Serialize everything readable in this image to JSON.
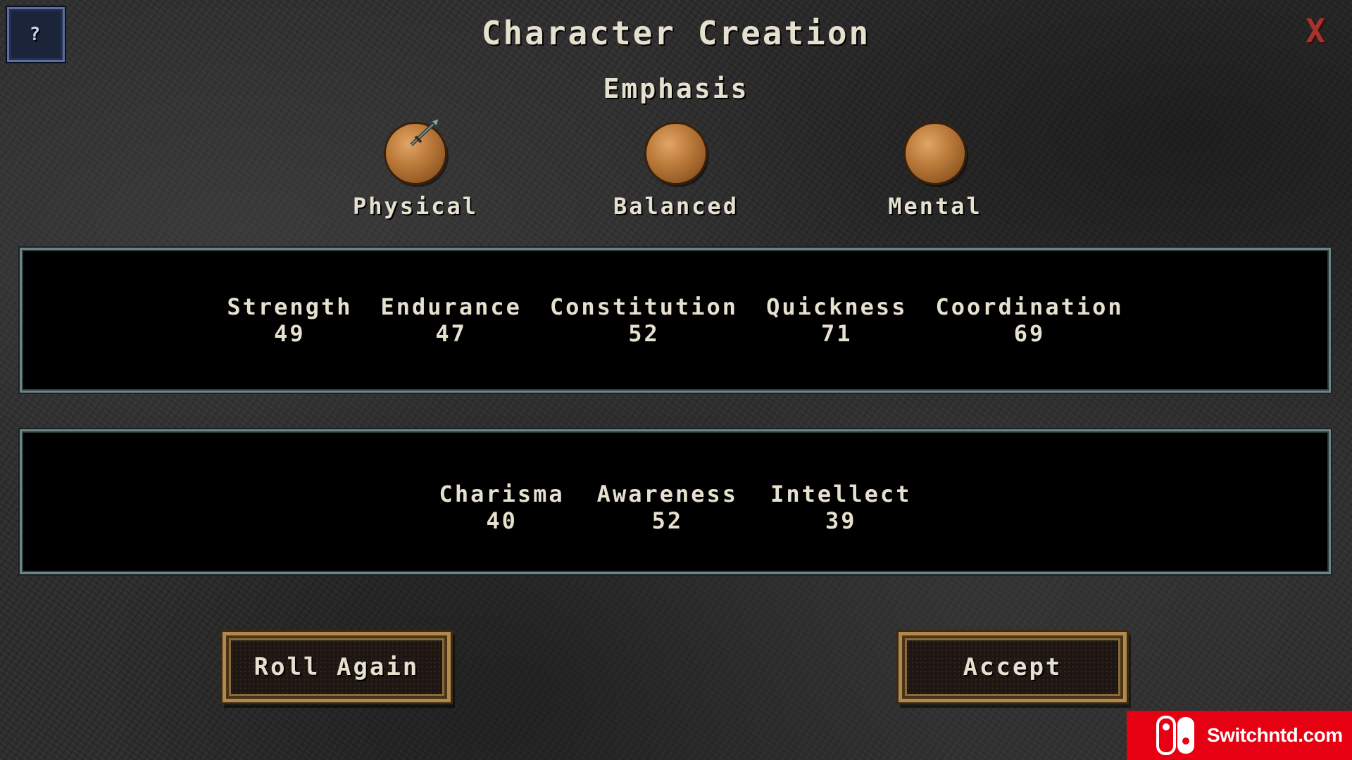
{
  "header": {
    "help_label": "?",
    "title": "Character Creation",
    "close_label": "X"
  },
  "emphasis": {
    "label": "Emphasis",
    "options": [
      {
        "label": "Physical",
        "selected": true
      },
      {
        "label": "Balanced",
        "selected": false
      },
      {
        "label": "Mental",
        "selected": false
      }
    ]
  },
  "physical_stats": [
    {
      "name": "Strength",
      "value": "49"
    },
    {
      "name": "Endurance",
      "value": "47"
    },
    {
      "name": "Constitution",
      "value": "52"
    },
    {
      "name": "Quickness",
      "value": "71"
    },
    {
      "name": "Coordination",
      "value": "69"
    }
  ],
  "mental_stats": [
    {
      "name": "Charisma",
      "value": "40"
    },
    {
      "name": "Awareness",
      "value": "52"
    },
    {
      "name": "Intellect",
      "value": "39"
    }
  ],
  "buttons": {
    "roll_again": "Roll Again",
    "accept": "Accept"
  },
  "watermark": {
    "text": "Switchntd.com",
    "brand_color": "#e60012"
  },
  "colors": {
    "text": "#e6e0cf",
    "close": "#a8322c",
    "panel_border": "#6f8486",
    "button_border": "#b0894f"
  }
}
